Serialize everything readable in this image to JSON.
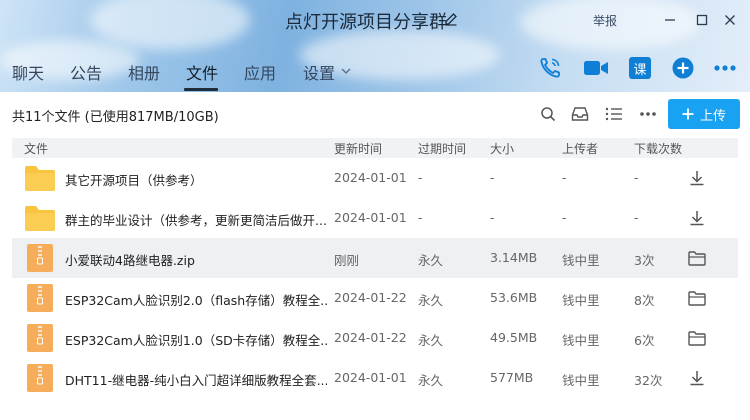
{
  "window": {
    "title": "点灯开源项目分享群",
    "report_label": "举报"
  },
  "tabs": [
    {
      "label": "聊天"
    },
    {
      "label": "公告"
    },
    {
      "label": "相册"
    },
    {
      "label": "文件"
    },
    {
      "label": "应用"
    },
    {
      "label": "设置"
    }
  ],
  "header_icons": {
    "call": "phone-icon",
    "video": "video-icon",
    "course": "课",
    "add": "plus-icon",
    "more": "more-icon"
  },
  "toolbar": {
    "count": "共11个文件 (已使用817MB/10GB)",
    "upload_label": "上传"
  },
  "columns": [
    "文件",
    "更新时间",
    "过期时间",
    "大小",
    "上传者",
    "下载次数"
  ],
  "files": [
    {
      "name": "其它开源项目（供参考）",
      "type": "folder",
      "time": "2024-01-01",
      "expire": "-",
      "size": "-",
      "uploader": "-",
      "downloads": "-",
      "action": "download-icon"
    },
    {
      "name": "群主的毕业设计（供参考，更新更简洁后做开...",
      "type": "folder",
      "time": "2024-01-01",
      "expire": "-",
      "size": "-",
      "uploader": "-",
      "downloads": "-",
      "action": "download-icon"
    },
    {
      "name": "小爱联动4路继电器.zip",
      "type": "zip",
      "time": "刚刚",
      "expire": "永久",
      "size": "3.14MB",
      "uploader": "钱中里",
      "downloads": "3次",
      "action": "folder-icon"
    },
    {
      "name": "ESP32Cam人脸识别2.0（flash存储）教程全...",
      "type": "zip",
      "time": "2024-01-22",
      "expire": "永久",
      "size": "53.6MB",
      "uploader": "钱中里",
      "downloads": "8次",
      "action": "folder-icon"
    },
    {
      "name": "ESP32Cam人脸识别1.0（SD卡存储）教程全...",
      "type": "zip",
      "time": "2024-01-22",
      "expire": "永久",
      "size": "49.5MB",
      "uploader": "钱中里",
      "downloads": "6次",
      "action": "folder-icon"
    },
    {
      "name": "DHT11-继电器-纯小白入门超详细版教程全套...",
      "type": "zip",
      "time": "2024-01-01",
      "expire": "永久",
      "size": "577MB",
      "uploader": "钱中里",
      "downloads": "32次",
      "action": "download-icon"
    }
  ],
  "colors": {
    "accent": "#19a1f2",
    "folder": "#f9c440",
    "zip": "#f5ad5b",
    "selected_row": "#eef0f3"
  }
}
